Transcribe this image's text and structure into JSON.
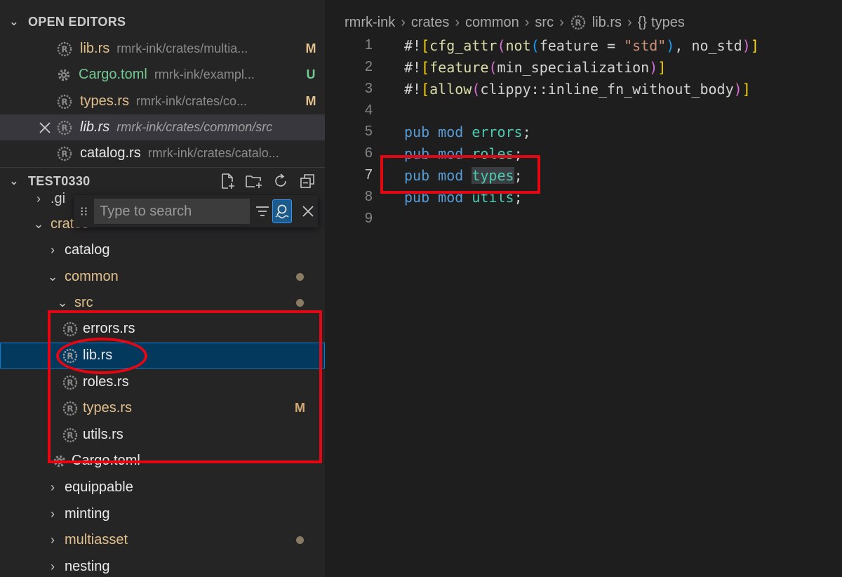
{
  "sidebar": {
    "open_editors": {
      "title": "OPEN EDITORS",
      "items": [
        {
          "name": "lib.rs",
          "path": "rmrk-ink/crates/multia...",
          "badge": "M"
        },
        {
          "name": "Cargo.toml",
          "path": "rmrk-ink/exampl...",
          "badge": "U"
        },
        {
          "name": "types.rs",
          "path": "rmrk-ink/crates/co...",
          "badge": "M"
        },
        {
          "name": "lib.rs",
          "path": "rmrk-ink/crates/common/src",
          "badge": ""
        },
        {
          "name": "catalog.rs",
          "path": "rmrk-ink/crates/catalo...",
          "badge": ""
        }
      ]
    },
    "explorer": {
      "title": "TEST0330",
      "search_placeholder": "Type to search",
      "items": [
        {
          "label": ".gi"
        },
        {
          "label": "crates"
        },
        {
          "label": "catalog"
        },
        {
          "label": "common"
        },
        {
          "label": "src"
        },
        {
          "label": "errors.rs"
        },
        {
          "label": "lib.rs"
        },
        {
          "label": "roles.rs"
        },
        {
          "label": "types.rs",
          "badge": "M"
        },
        {
          "label": "utils.rs"
        },
        {
          "label": "Cargo.toml"
        },
        {
          "label": "equippable"
        },
        {
          "label": "minting"
        },
        {
          "label": "multiasset"
        },
        {
          "label": "nesting"
        }
      ]
    }
  },
  "editor": {
    "breadcrumbs": [
      "rmrk-ink",
      "crates",
      "common",
      "src",
      "lib.rs",
      "types"
    ],
    "breadcrumb_symbol": "{}",
    "line_numbers": [
      "1",
      "2",
      "3",
      "4",
      "5",
      "6",
      "7",
      "8",
      "9"
    ],
    "code": {
      "l1": {
        "prefix": "#!",
        "o1": "[",
        "fn1": "cfg_attr",
        "o2": "(",
        "fn2": "not",
        "o3": "(",
        "mid": "feature = ",
        "str": "\"std\"",
        "c3": ")",
        "tail": ", no_std",
        "c2": ")",
        "c1": "]"
      },
      "l2": {
        "prefix": "#!",
        "o1": "[",
        "fn1": "feature",
        "o2": "(",
        "mid": "min_specialization",
        "c2": ")",
        "c1": "]"
      },
      "l3": {
        "prefix": "#!",
        "o1": "[",
        "fn1": "allow",
        "o2": "(",
        "mid": "clippy::inline_fn_without_body",
        "c2": ")",
        "c1": "]"
      },
      "l5": {
        "kw1": "pub",
        "kw2": "mod",
        "name": "errors",
        "semi": ";"
      },
      "l6": {
        "kw1": "pub",
        "kw2": "mod",
        "name": "roles",
        "semi": ";"
      },
      "l7": {
        "kw1": "pub",
        "kw2": "mod",
        "name": "types",
        "semi": ";"
      },
      "l8": {
        "kw1": "pub",
        "kw2": "mod",
        "name": "utils",
        "semi": ";"
      }
    }
  },
  "colors": {
    "annotation": "#e30613",
    "selection": "#04395e",
    "modified": "#e2c08d",
    "untracked": "#73c991"
  }
}
